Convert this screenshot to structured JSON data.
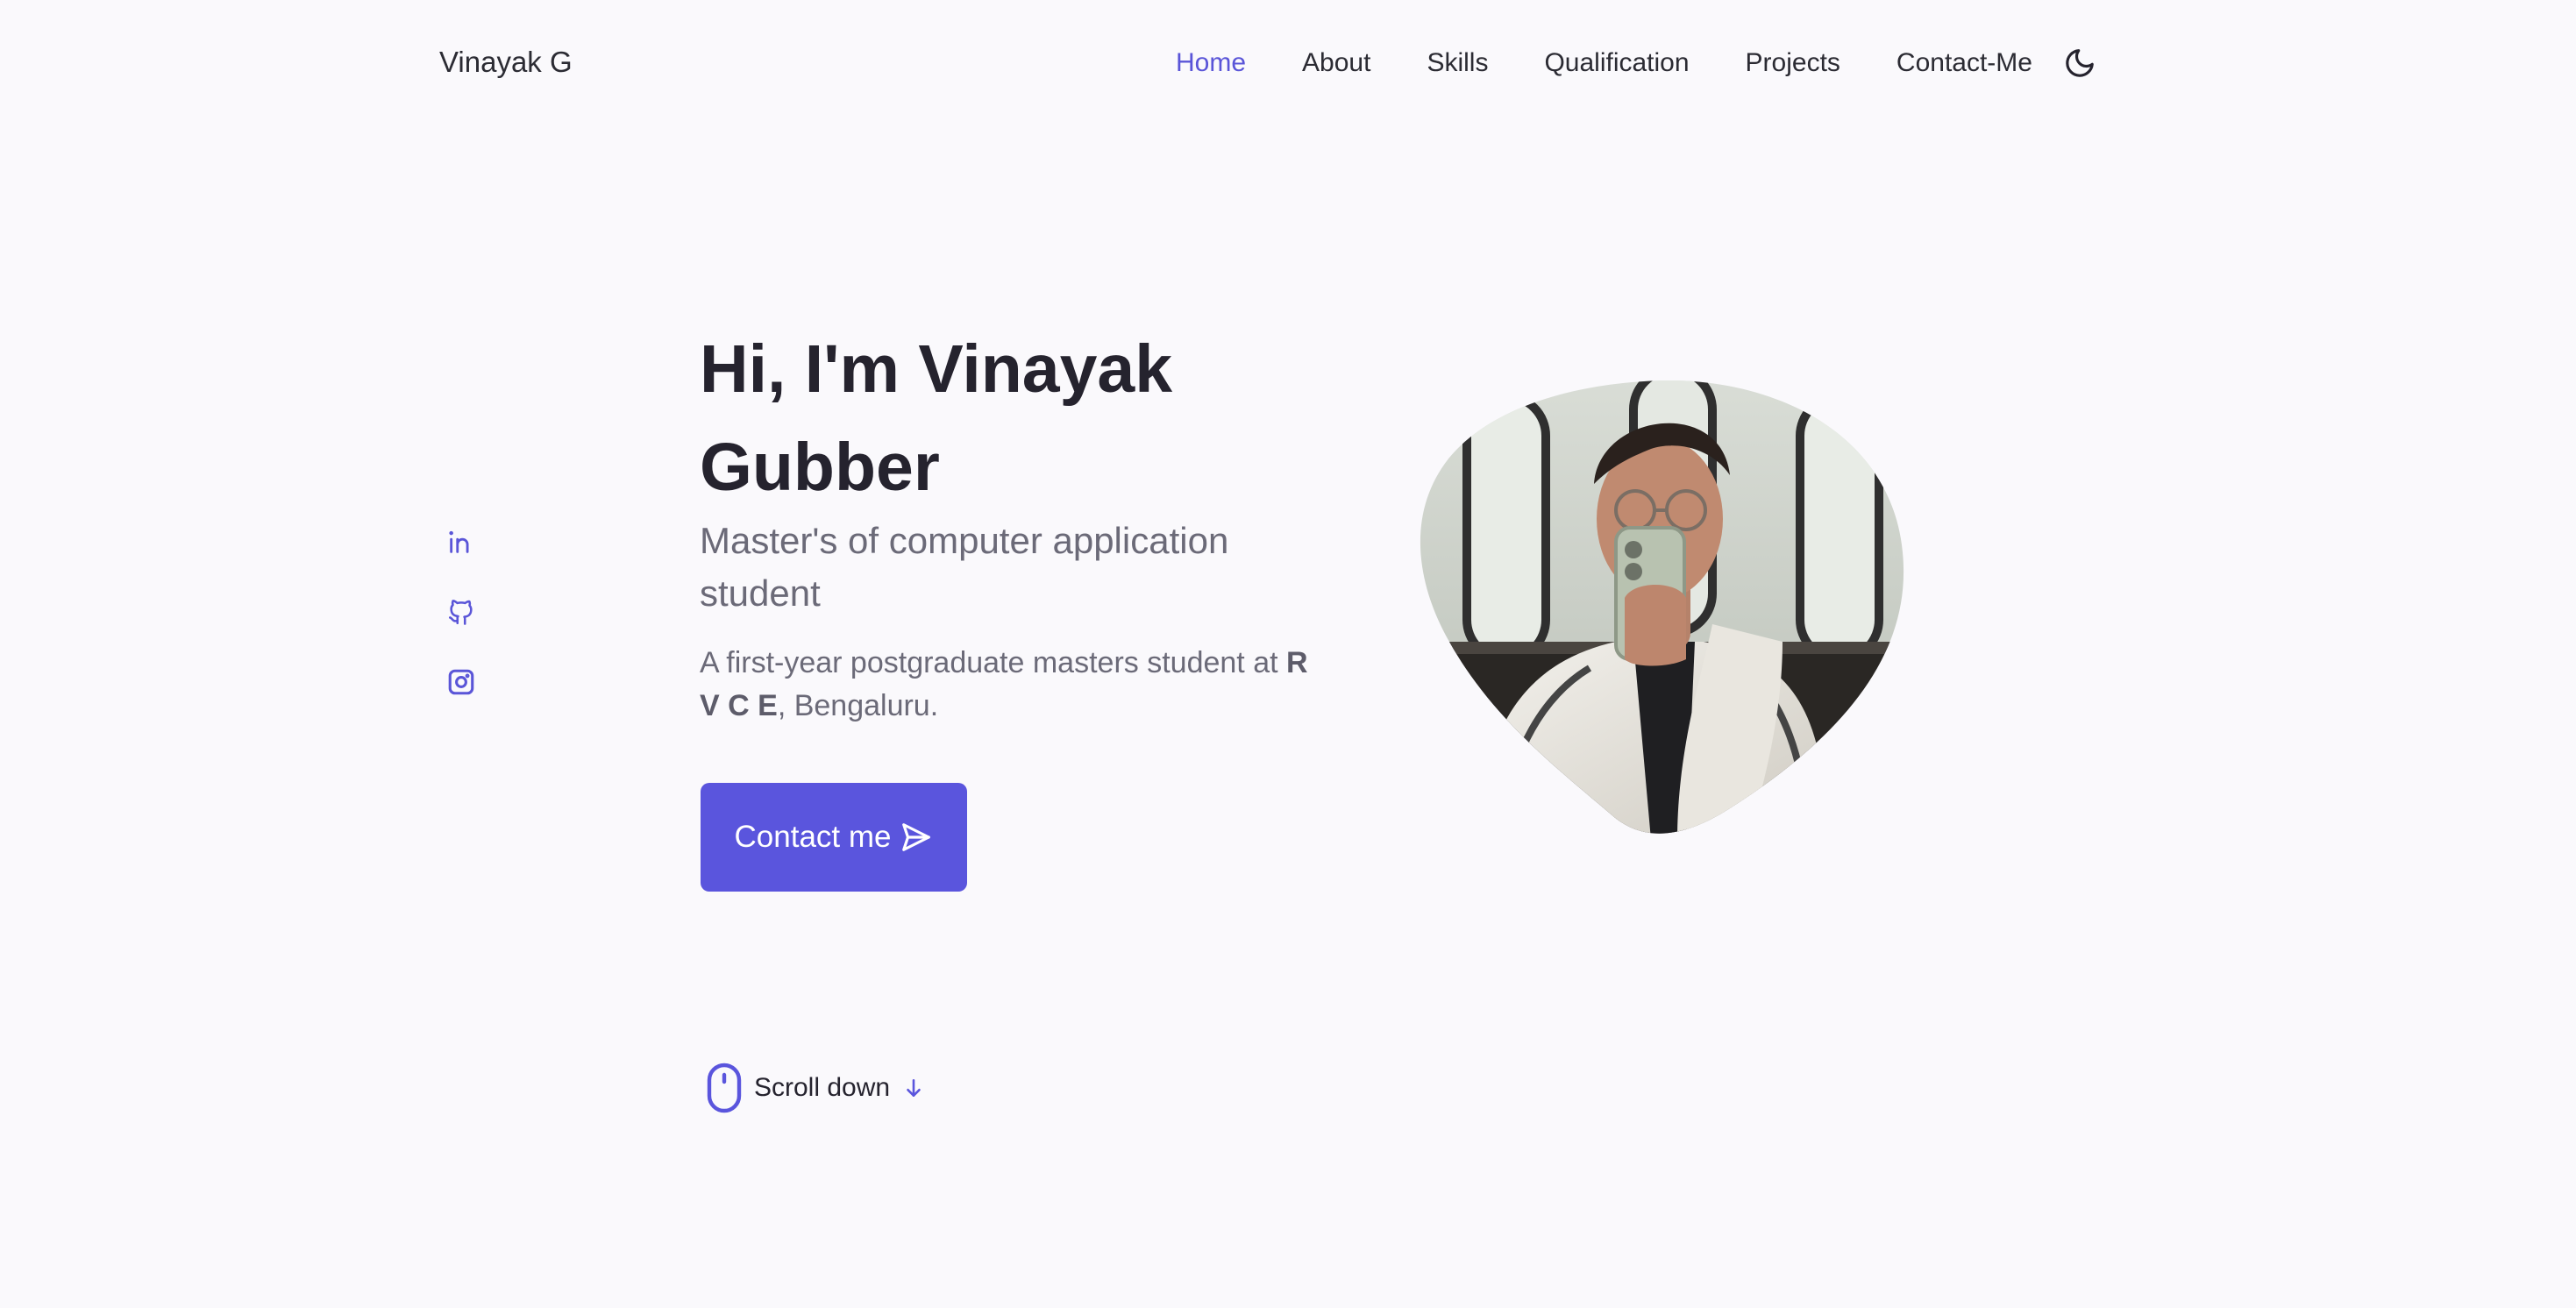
{
  "header": {
    "logo": "Vinayak G",
    "nav": [
      {
        "label": "Home",
        "active": true
      },
      {
        "label": "About"
      },
      {
        "label": "Skills"
      },
      {
        "label": "Qualification"
      },
      {
        "label": "Projects"
      },
      {
        "label": "Contact-Me"
      }
    ],
    "theme_icon": "moon-icon"
  },
  "social": [
    {
      "icon": "linkedin-icon"
    },
    {
      "icon": "github-icon"
    },
    {
      "icon": "instagram-icon"
    }
  ],
  "hero": {
    "title": "Hi, I'm Vinayak Gubber",
    "subtitle": "Master's of computer application student",
    "desc_prefix": "A first-year postgraduate masters student at ",
    "desc_bold": "R V C E",
    "desc_suffix": ", Bengaluru.",
    "button_label": "Contact me",
    "button_icon": "send-icon",
    "image_alt": "profile-photo"
  },
  "scroll": {
    "label": "Scroll down",
    "mouse_icon": "mouse-icon",
    "arrow_icon": "arrow-down-icon"
  },
  "colors": {
    "accent": "#5a55dd",
    "background": "#faf9fc",
    "text": "#25232e",
    "muted": "#6b6a78"
  }
}
